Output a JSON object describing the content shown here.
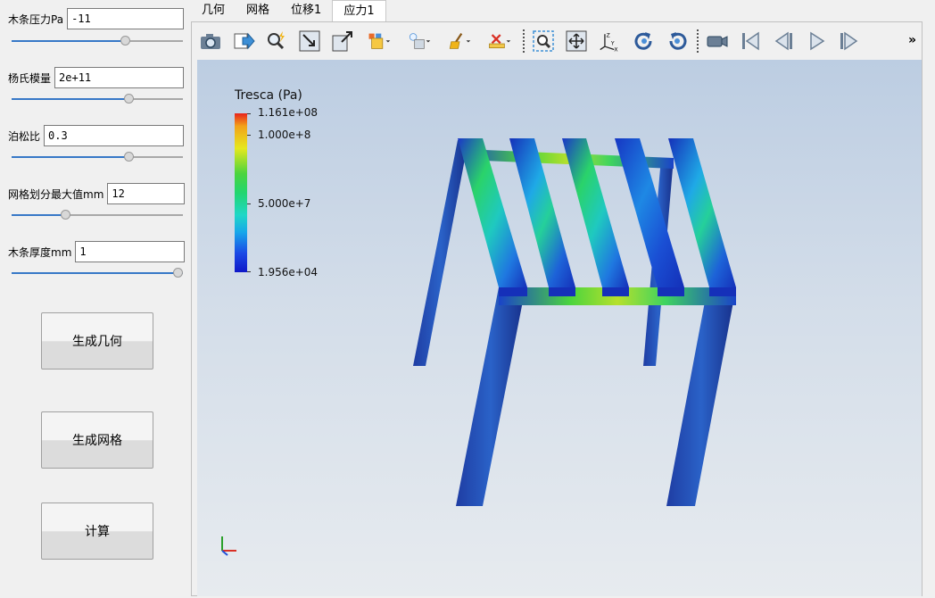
{
  "params": {
    "pressure": {
      "label": "木条压力Pa",
      "value": "-11",
      "slider": 0.66
    },
    "youngs": {
      "label": "杨氏模量",
      "value": "2e+11",
      "slider": 0.68
    },
    "poisson": {
      "label": "泊松比",
      "value": "0.3",
      "slider": 0.68
    },
    "mesh_max": {
      "label": "网格划分最大值mm",
      "value": "12",
      "slider": 0.31
    },
    "thickness": {
      "label": "木条厚度mm",
      "value": "1",
      "slider": 1.0
    }
  },
  "buttons": {
    "gen_geom": "生成几何",
    "gen_mesh": "生成网格",
    "compute": "计算"
  },
  "tabs": [
    "几何",
    "网格",
    "位移1",
    "应力1"
  ],
  "active_tab": "应力1",
  "toolbar_more": "»",
  "legend": {
    "title": "Tresca (Pa)",
    "max": "1.161e+08",
    "t1": "1.000e+8",
    "t2": "5.000e+7",
    "min": "1.956e+04"
  },
  "colors": {
    "accent": "#3778c7",
    "high": "#e8221b",
    "low": "#1018c8"
  }
}
